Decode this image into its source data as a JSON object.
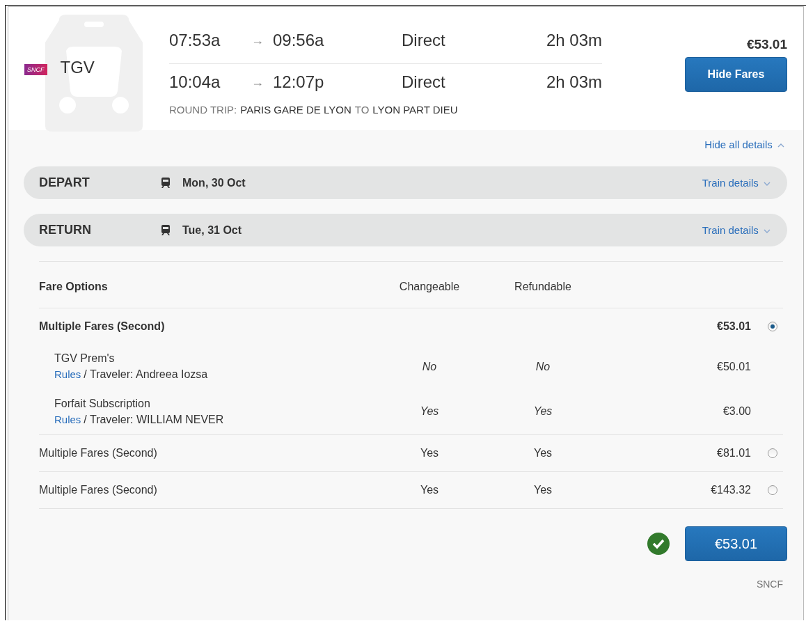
{
  "carrier": {
    "logo": "SNCF",
    "name": "TGV"
  },
  "trips": [
    {
      "depart": "07:53a",
      "arrow": "→",
      "arrive": "09:56a",
      "stops": "Direct",
      "duration": "2h 03m"
    },
    {
      "depart": "10:04a",
      "arrow": "→",
      "arrive": "12:07p",
      "stops": "Direct",
      "duration": "2h 03m"
    }
  ],
  "route": {
    "label": "ROUND TRIP:",
    "origin": "PARIS GARE DE LYON",
    "connector": "TO",
    "destination": "LYON PART DIEU"
  },
  "price": "€53.01",
  "hide_fares_button": "Hide Fares",
  "hide_details_link": "Hide all details",
  "legs": [
    {
      "label": "DEPART",
      "date": "Mon, 30 Oct",
      "link": "Train details"
    },
    {
      "label": "RETURN",
      "date": "Tue, 31 Oct",
      "link": "Train details"
    }
  ],
  "fare_table": {
    "columns": [
      "Fare Options",
      "Changeable",
      "Refundable"
    ],
    "fares": [
      {
        "kind": "group",
        "name": "Multiple Fares (Second)",
        "price": "€53.01",
        "selected": true,
        "components": [
          {
            "name": "TGV Prem's",
            "rules": "Rules",
            "traveler": "/ Traveler: Andreea Iozsa",
            "changeable": "No",
            "refundable": "No",
            "price": "€50.01"
          },
          {
            "name": "Forfait Subscription",
            "rules": "Rules",
            "traveler": "/ Traveler: WILLIAM NEVER",
            "changeable": "Yes",
            "refundable": "Yes",
            "price": "€3.00"
          }
        ]
      },
      {
        "kind": "single",
        "name": "Multiple Fares (Second)",
        "changeable": "Yes",
        "refundable": "Yes",
        "price": "€81.01",
        "selected": false
      },
      {
        "kind": "single",
        "name": "Multiple Fares (Second)",
        "changeable": "Yes",
        "refundable": "Yes",
        "price": "€143.32",
        "selected": false
      }
    ]
  },
  "confirmed": true,
  "select_button": "€53.01",
  "provider": "SNCF"
}
